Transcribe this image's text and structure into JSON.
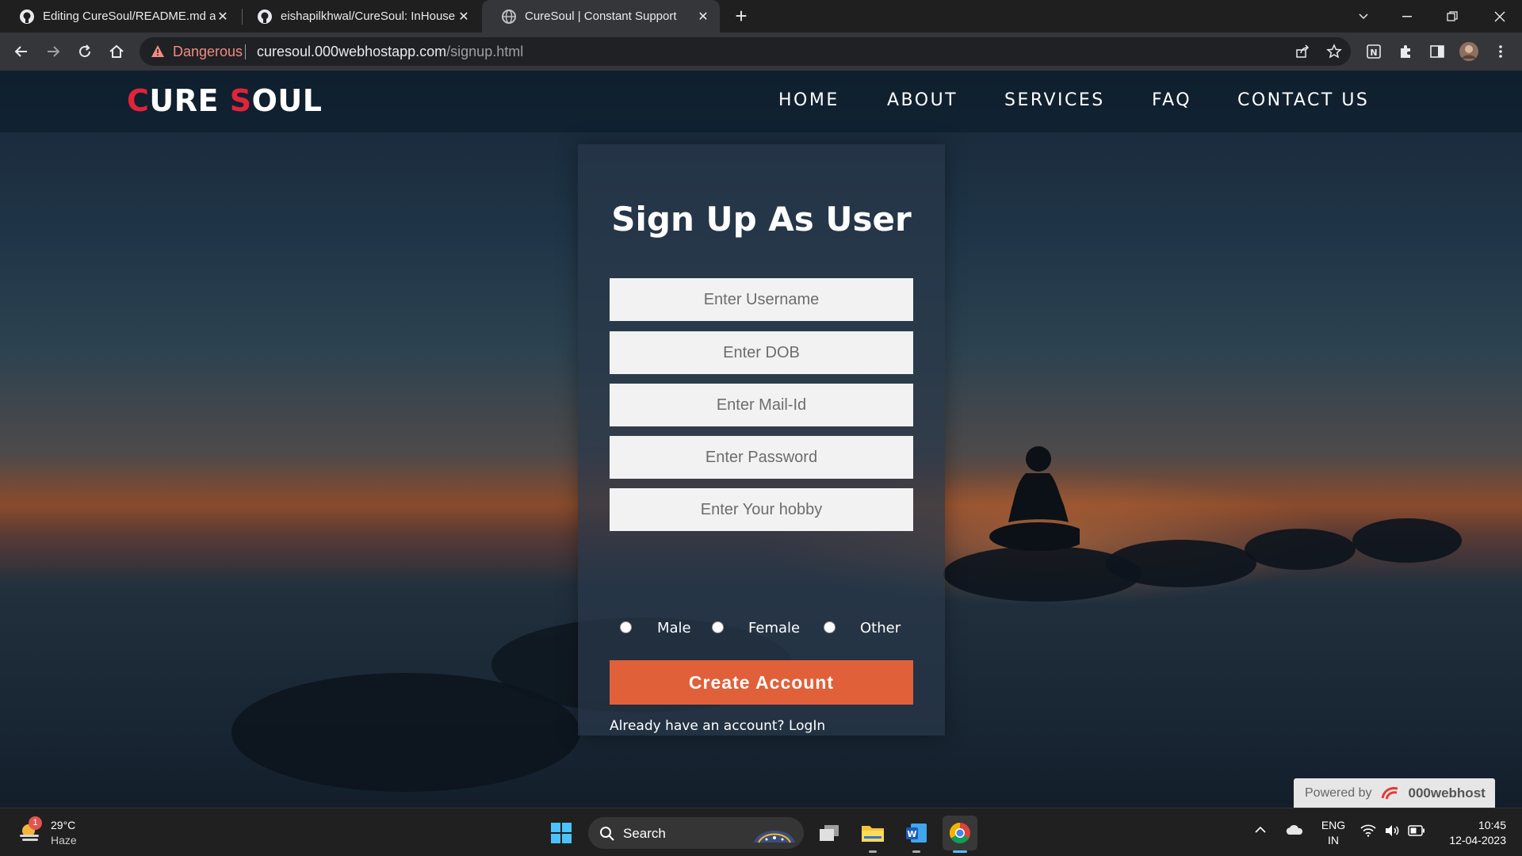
{
  "browser": {
    "tabs": [
      {
        "title": "Editing CureSoul/README.md at",
        "icon": "github-icon",
        "active": false
      },
      {
        "title": "eishapilkhwal/CureSoul: InHouse",
        "icon": "github-icon",
        "active": false
      },
      {
        "title": "CureSoul | Constant Support",
        "icon": "globe-icon",
        "active": true
      }
    ],
    "security_label": "Dangerous",
    "url_host": "curesoul.000webhostapp.com",
    "url_path": "/signup.html"
  },
  "site": {
    "logo": {
      "c": "C",
      "ure": "URE ",
      "s": "S",
      "oul": "OUL"
    },
    "nav": [
      "HOME",
      "ABOUT",
      "SERVICES",
      "FAQ",
      "CONTACT US"
    ],
    "accent_color": "#e2233a"
  },
  "signup": {
    "title": "Sign Up As User",
    "fields": [
      {
        "placeholder": "Enter Username"
      },
      {
        "placeholder": "Enter DOB"
      },
      {
        "placeholder": "Enter Mail-Id"
      },
      {
        "placeholder": "Enter Password"
      },
      {
        "placeholder": "Enter Your hobby"
      }
    ],
    "gender_options": [
      "Male",
      "Female",
      "Other"
    ],
    "button_label": "Create Account",
    "button_color": "#e0603a",
    "login_prompt": "Already have an account? LogIn"
  },
  "hosting_badge": {
    "prefix": "Powered by",
    "brand": "000webhost"
  },
  "taskbar": {
    "weather_badge": "1",
    "temperature": "29°C",
    "condition": "Haze",
    "search_label": "Search",
    "language_top": "ENG",
    "language_bottom": "IN",
    "time": "10:45",
    "date": "12-04-2023"
  }
}
